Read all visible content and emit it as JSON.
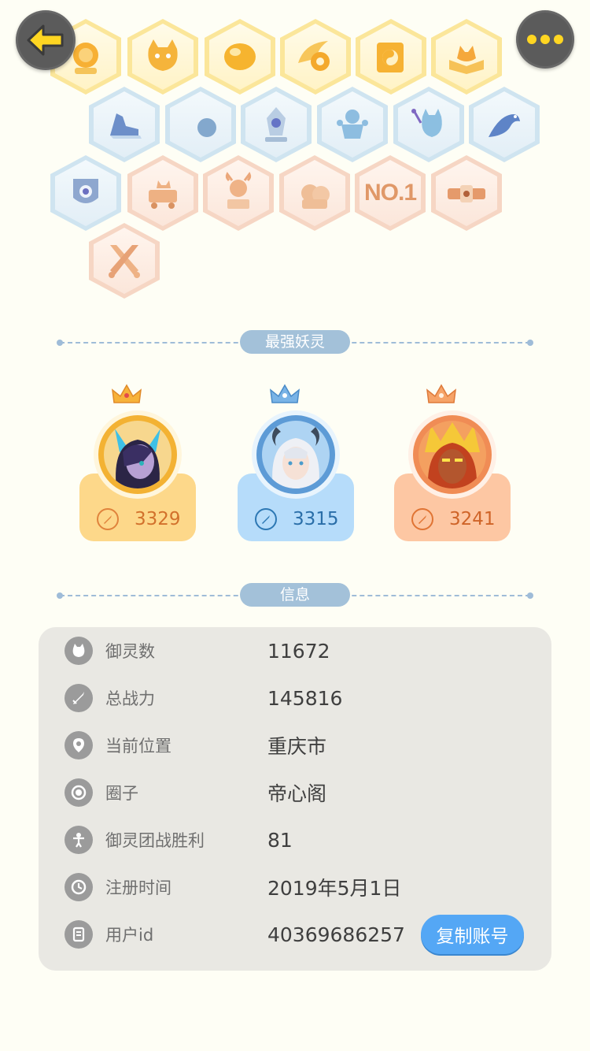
{
  "nav": {
    "back_icon": "arrow-left-icon",
    "more_icon": "more-dots-icon",
    "accent": "#ffd622"
  },
  "badges": [
    {
      "icon": "sun-icon",
      "tier": "gold"
    },
    {
      "icon": "cat-face-icon",
      "tier": "gold"
    },
    {
      "icon": "orb-icon",
      "tier": "gold"
    },
    {
      "icon": "yinyang-flame-icon",
      "tier": "gold"
    },
    {
      "icon": "yinyang-scroll-icon",
      "tier": "gold"
    },
    {
      "icon": "fox-book-icon",
      "tier": "gold"
    },
    {
      "icon": "sneaker-icon",
      "tier": "blue"
    },
    {
      "icon": "moon-icon",
      "tier": "blue"
    },
    {
      "icon": "crystal-icon",
      "tier": "blue"
    },
    {
      "icon": "spirit-figure-icon",
      "tier": "blue"
    },
    {
      "icon": "cat-wand-icon",
      "tier": "blue"
    },
    {
      "icon": "dragon-icon",
      "tier": "blue"
    },
    {
      "icon": "shield-ring-icon",
      "tier": "blue"
    },
    {
      "icon": "cat-cart-icon",
      "tier": "peach"
    },
    {
      "icon": "ox-statue-icon",
      "tier": "peach"
    },
    {
      "icon": "cat-pair-icon",
      "tier": "peach"
    },
    {
      "icon": "no1-icon",
      "tier": "peach",
      "text": "NO.1"
    },
    {
      "icon": "belt-icon",
      "tier": "peach"
    },
    {
      "icon": "crossed-swords-icon",
      "tier": "peach"
    }
  ],
  "sections": {
    "top_spirits_title": "最强妖灵",
    "info_title": "信息"
  },
  "top_spirits": [
    {
      "rank": "gold",
      "value": "3329",
      "avatar": "fox-girl-avatar"
    },
    {
      "rank": "blue",
      "value": "3315",
      "avatar": "horned-girl-avatar"
    },
    {
      "rank": "peach",
      "value": "3241",
      "avatar": "flame-demon-avatar"
    }
  ],
  "info": {
    "rows": [
      {
        "icon": "cat-icon",
        "label": "御灵数",
        "value": "11672"
      },
      {
        "icon": "sword-icon",
        "label": "总战力",
        "value": "145816"
      },
      {
        "icon": "location-icon",
        "label": "当前位置",
        "value": "重庆市"
      },
      {
        "icon": "circle-target-icon",
        "label": "圈子",
        "value": "帝心阁"
      },
      {
        "icon": "trophy-figure-icon",
        "label": "御灵团战胜利",
        "value": "81"
      },
      {
        "icon": "clock-icon",
        "label": "注册时间",
        "value": "2019年5月1日"
      },
      {
        "icon": "id-card-icon",
        "label": "用户id",
        "value": "40369686257"
      }
    ],
    "copy_button": "复制账号"
  }
}
